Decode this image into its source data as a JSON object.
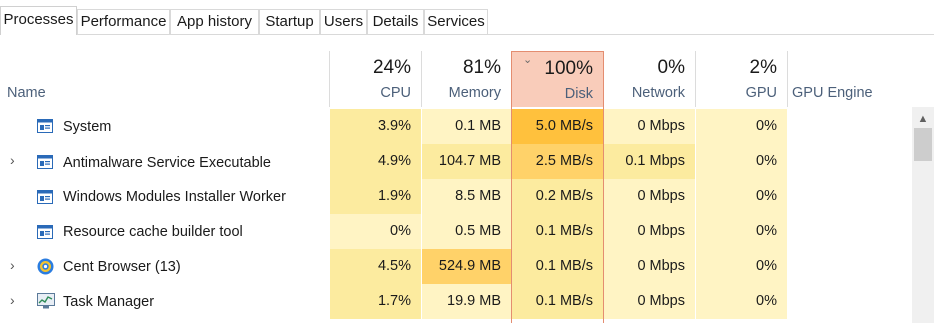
{
  "tabs": [
    "Processes",
    "Performance",
    "App history",
    "Startup",
    "Users",
    "Details",
    "Services"
  ],
  "header": {
    "name_label": "Name",
    "gpu_engine_label": "GPU Engine",
    "sort_indicator": "chevron-down-icon",
    "columns": [
      {
        "pct": "24%",
        "label": "CPU"
      },
      {
        "pct": "81%",
        "label": "Memory"
      },
      {
        "pct": "100%",
        "label": "Disk"
      },
      {
        "pct": "0%",
        "label": "Network"
      },
      {
        "pct": "2%",
        "label": "GPU"
      }
    ]
  },
  "colors": {
    "heat_low": "#fff4c4",
    "heat_mid": "#fceb9f",
    "heat_high": "#ffd269",
    "heat_max": "#ffc13d",
    "disk_header": "#f9ccba",
    "header_text": "#4c607a"
  },
  "rows": [
    {
      "expandable": false,
      "icon": "app-window-icon",
      "name": "System",
      "cpu": "3.9%",
      "memory": "0.1 MB",
      "disk": "5.0 MB/s",
      "network": "0 Mbps",
      "gpu": "0%"
    },
    {
      "expandable": true,
      "icon": "app-window-icon",
      "name": "Antimalware Service Executable",
      "cpu": "4.9%",
      "memory": "104.7 MB",
      "disk": "2.5 MB/s",
      "network": "0.1 Mbps",
      "gpu": "0%"
    },
    {
      "expandable": false,
      "icon": "app-window-icon",
      "name": "Windows Modules Installer Worker",
      "cpu": "1.9%",
      "memory": "8.5 MB",
      "disk": "0.2 MB/s",
      "network": "0 Mbps",
      "gpu": "0%"
    },
    {
      "expandable": false,
      "icon": "app-window-icon",
      "name": "Resource cache builder tool",
      "cpu": "0%",
      "memory": "0.5 MB",
      "disk": "0.1 MB/s",
      "network": "0 Mbps",
      "gpu": "0%"
    },
    {
      "expandable": true,
      "icon": "cent-browser-icon",
      "name": "Cent Browser (13)",
      "cpu": "4.5%",
      "memory": "524.9 MB",
      "disk": "0.1 MB/s",
      "network": "0 Mbps",
      "gpu": "0%"
    },
    {
      "expandable": true,
      "icon": "task-manager-icon",
      "name": "Task Manager",
      "cpu": "1.7%",
      "memory": "19.9 MB",
      "disk": "0.1 MB/s",
      "network": "0 Mbps",
      "gpu": "0%"
    }
  ]
}
